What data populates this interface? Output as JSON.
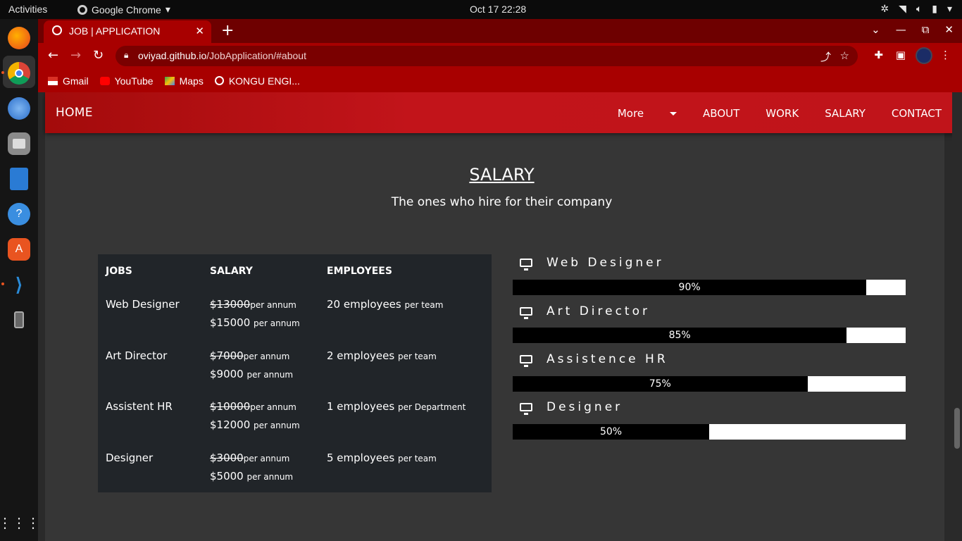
{
  "topbar": {
    "activities": "Activities",
    "app": "Google Chrome",
    "clock": "Oct 17  22:28"
  },
  "browser": {
    "tab_title": "JOB | APPLICATION",
    "url_host": "oviyad.github.io",
    "url_path": "/JobApplication/#about",
    "bookmarks": [
      "Gmail",
      "YouTube",
      "Maps",
      "KONGU ENGI..."
    ]
  },
  "nav": {
    "brand": "HOME",
    "links": [
      "More",
      "ABOUT",
      "WORK",
      "SALARY",
      "CONTACT"
    ]
  },
  "section": {
    "title": "SALARY",
    "subtitle": "The ones who hire for their company"
  },
  "table": {
    "headers": [
      "JOBS",
      "SALARY",
      "EMPLOYEES"
    ],
    "rows": [
      {
        "job": "Web Designer",
        "old": "$13000",
        "old_unit": "per annum",
        "new": "$15000",
        "new_unit": "per annum",
        "emp": "20 employees",
        "emp_unit": "per team"
      },
      {
        "job": "Art Director",
        "old": "$7000",
        "old_unit": "per annum",
        "new": "$9000",
        "new_unit": "per annum",
        "emp": "2 employees",
        "emp_unit": "per team"
      },
      {
        "job": "Assistent HR",
        "old": "$10000",
        "old_unit": "per annum",
        "new": "$12000",
        "new_unit": "per annum",
        "emp": "1 employees",
        "emp_unit": "per Department"
      },
      {
        "job": "Designer",
        "old": "$3000",
        "old_unit": "per annum",
        "new": "$5000",
        "new_unit": "per annum",
        "emp": "5 employees",
        "emp_unit": "per team"
      }
    ]
  },
  "skills": [
    {
      "label": "Web Designer",
      "percent": 90,
      "text": "90%"
    },
    {
      "label": "Art Director",
      "percent": 85,
      "text": "85%"
    },
    {
      "label": "Assistence HR",
      "percent": 75,
      "text": "75%"
    },
    {
      "label": "Designer",
      "percent": 50,
      "text": "50%"
    }
  ]
}
